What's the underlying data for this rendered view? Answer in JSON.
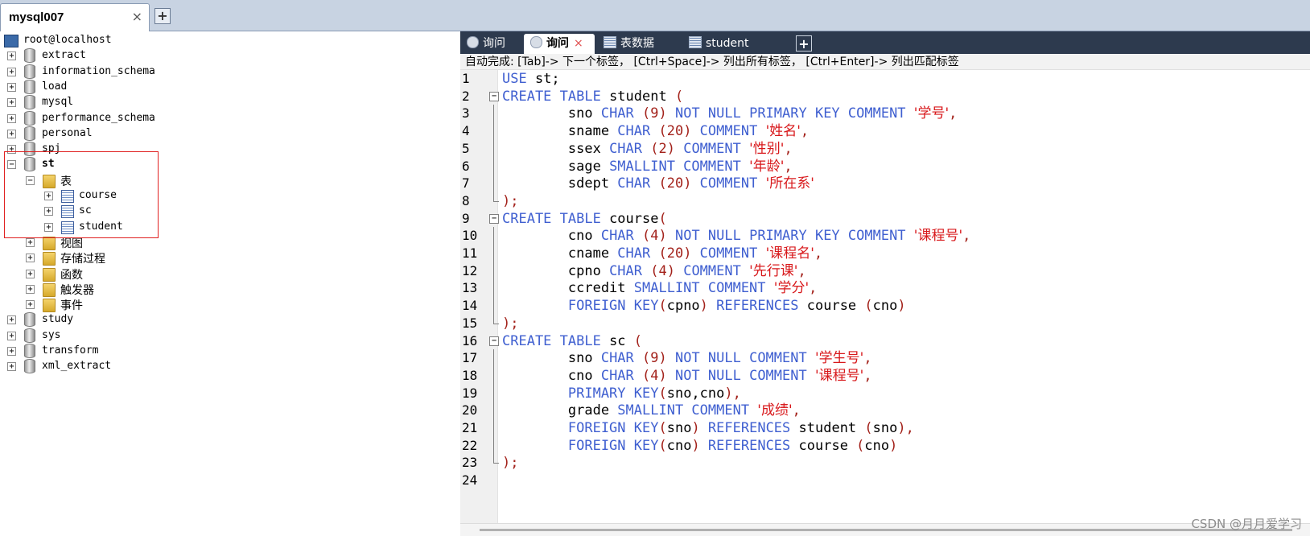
{
  "connection_tab": {
    "label": "mysql007",
    "close": "×",
    "add": "+"
  },
  "tree": {
    "rows": [
      {
        "level": 0,
        "icon": "host",
        "expander": "",
        "label": "root@localhost"
      },
      {
        "level": 1,
        "icon": "db",
        "expander": "+",
        "label": "extract"
      },
      {
        "level": 1,
        "icon": "db",
        "expander": "+",
        "label": "information_schema"
      },
      {
        "level": 1,
        "icon": "db",
        "expander": "+",
        "label": "load"
      },
      {
        "level": 1,
        "icon": "db",
        "expander": "+",
        "label": "mysql"
      },
      {
        "level": 1,
        "icon": "db",
        "expander": "+",
        "label": "performance_schema"
      },
      {
        "level": 1,
        "icon": "db",
        "expander": "+",
        "label": "personal"
      },
      {
        "level": 1,
        "icon": "db",
        "expander": "+",
        "label": "spj"
      },
      {
        "level": 1,
        "icon": "db",
        "expander": "−",
        "label": "st",
        "bold": true
      },
      {
        "level": 2,
        "icon": "folder",
        "expander": "−",
        "label": "表",
        "cn": true
      },
      {
        "level": 3,
        "icon": "table",
        "expander": "+",
        "label": "course"
      },
      {
        "level": 3,
        "icon": "table",
        "expander": "+",
        "label": "sc"
      },
      {
        "level": 3,
        "icon": "table",
        "expander": "+",
        "label": "student"
      },
      {
        "level": 2,
        "icon": "folder",
        "expander": "+",
        "label": "视图",
        "cn": true
      },
      {
        "level": 2,
        "icon": "folder",
        "expander": "+",
        "label": "存储过程",
        "cn": true
      },
      {
        "level": 2,
        "icon": "folder",
        "expander": "+",
        "label": "函数",
        "cn": true
      },
      {
        "level": 2,
        "icon": "folder",
        "expander": "+",
        "label": "触发器",
        "cn": true
      },
      {
        "level": 2,
        "icon": "folder",
        "expander": "+",
        "label": "事件",
        "cn": true
      },
      {
        "level": 1,
        "icon": "db",
        "expander": "+",
        "label": "study"
      },
      {
        "level": 1,
        "icon": "db",
        "expander": "+",
        "label": "sys"
      },
      {
        "level": 1,
        "icon": "db",
        "expander": "+",
        "label": "transform"
      },
      {
        "level": 1,
        "icon": "db",
        "expander": "+",
        "label": "xml_extract"
      }
    ]
  },
  "query_tabs": [
    {
      "label": "询问",
      "icon": "query-icon",
      "active": false
    },
    {
      "label": "询问",
      "icon": "query-icon",
      "active": true,
      "close": "×"
    },
    {
      "label": "表数据",
      "icon": "table-data-icon",
      "active": false
    },
    {
      "label": "student",
      "icon": "table-data-icon",
      "active": false
    }
  ],
  "add_query_tab": "+",
  "autocomplete_hint": "自动完成: [Tab]-> 下一个标签， [Ctrl+Space]-> 列出所有标签， [Ctrl+Enter]-> 列出匹配标签",
  "editor": {
    "lines": [
      {
        "n": "1",
        "fold": "",
        "tokens": [
          [
            "kw",
            "USE"
          ],
          [
            "id",
            " st;"
          ]
        ]
      },
      {
        "n": "2",
        "fold": "start",
        "tokens": [
          [
            "kw",
            "CREATE TABLE"
          ],
          [
            "id",
            " student "
          ],
          [
            "pun",
            "("
          ]
        ]
      },
      {
        "n": "3",
        "fold": "mid",
        "tokens": [
          [
            "id",
            "        sno "
          ],
          [
            "kw",
            "CHAR "
          ],
          [
            "pun",
            "(9) "
          ],
          [
            "kw",
            "NOT NULL PRIMARY KEY COMMENT "
          ],
          [
            "str",
            "'学号'"
          ],
          [
            "pun",
            ","
          ]
        ]
      },
      {
        "n": "4",
        "fold": "mid",
        "tokens": [
          [
            "id",
            "        sname "
          ],
          [
            "kw",
            "CHAR "
          ],
          [
            "pun",
            "(20) "
          ],
          [
            "kw",
            "COMMENT "
          ],
          [
            "str",
            "'姓名'"
          ],
          [
            "pun",
            ","
          ]
        ]
      },
      {
        "n": "5",
        "fold": "mid",
        "tokens": [
          [
            "id",
            "        ssex "
          ],
          [
            "kw",
            "CHAR "
          ],
          [
            "pun",
            "(2) "
          ],
          [
            "kw",
            "COMMENT "
          ],
          [
            "str",
            "'性别'"
          ],
          [
            "pun",
            ","
          ]
        ]
      },
      {
        "n": "6",
        "fold": "mid",
        "tokens": [
          [
            "id",
            "        sage "
          ],
          [
            "kw",
            "SMALLINT COMMENT "
          ],
          [
            "str",
            "'年龄'"
          ],
          [
            "pun",
            ","
          ]
        ]
      },
      {
        "n": "7",
        "fold": "mid",
        "tokens": [
          [
            "id",
            "        sdept "
          ],
          [
            "kw",
            "CHAR "
          ],
          [
            "pun",
            "(20) "
          ],
          [
            "kw",
            "COMMENT "
          ],
          [
            "str",
            "'所在系'"
          ]
        ]
      },
      {
        "n": "8",
        "fold": "end",
        "tokens": [
          [
            "pun",
            ");"
          ]
        ]
      },
      {
        "n": "9",
        "fold": "start",
        "tokens": [
          [
            "kw",
            "CREATE TABLE"
          ],
          [
            "id",
            " course"
          ],
          [
            "pun",
            "("
          ]
        ]
      },
      {
        "n": "10",
        "fold": "mid",
        "tokens": [
          [
            "id",
            "        cno "
          ],
          [
            "kw",
            "CHAR "
          ],
          [
            "pun",
            "(4) "
          ],
          [
            "kw",
            "NOT NULL PRIMARY KEY COMMENT "
          ],
          [
            "str",
            "'课程号'"
          ],
          [
            "pun",
            ","
          ]
        ]
      },
      {
        "n": "11",
        "fold": "mid",
        "tokens": [
          [
            "id",
            "        cname "
          ],
          [
            "kw",
            "CHAR "
          ],
          [
            "pun",
            "(20) "
          ],
          [
            "kw",
            "COMMENT "
          ],
          [
            "str",
            "'课程名'"
          ],
          [
            "pun",
            ","
          ]
        ]
      },
      {
        "n": "12",
        "fold": "mid",
        "tokens": [
          [
            "id",
            "        cpno "
          ],
          [
            "kw",
            "CHAR "
          ],
          [
            "pun",
            "(4) "
          ],
          [
            "kw",
            "COMMENT "
          ],
          [
            "str",
            "'先行课'"
          ],
          [
            "pun",
            ","
          ]
        ]
      },
      {
        "n": "13",
        "fold": "mid",
        "tokens": [
          [
            "id",
            "        ccredit "
          ],
          [
            "kw",
            "SMALLINT COMMENT "
          ],
          [
            "str",
            "'学分'"
          ],
          [
            "pun",
            ","
          ]
        ]
      },
      {
        "n": "14",
        "fold": "mid",
        "tokens": [
          [
            "kw",
            "        FOREIGN KEY"
          ],
          [
            "pun",
            "("
          ],
          [
            "id",
            "cpno"
          ],
          [
            "pun",
            ") "
          ],
          [
            "kw",
            "REFERENCES"
          ],
          [
            "id",
            " course "
          ],
          [
            "pun",
            "("
          ],
          [
            "id",
            "cno"
          ],
          [
            "pun",
            ")"
          ]
        ]
      },
      {
        "n": "15",
        "fold": "end",
        "tokens": [
          [
            "pun",
            ");"
          ]
        ]
      },
      {
        "n": "16",
        "fold": "start",
        "tokens": [
          [
            "kw",
            "CREATE TABLE"
          ],
          [
            "id",
            " sc "
          ],
          [
            "pun",
            "("
          ]
        ]
      },
      {
        "n": "17",
        "fold": "mid",
        "tokens": [
          [
            "id",
            "        sno "
          ],
          [
            "kw",
            "CHAR "
          ],
          [
            "pun",
            "(9) "
          ],
          [
            "kw",
            "NOT NULL COMMENT "
          ],
          [
            "str",
            "'学生号'"
          ],
          [
            "pun",
            ","
          ]
        ]
      },
      {
        "n": "18",
        "fold": "mid",
        "tokens": [
          [
            "id",
            "        cno "
          ],
          [
            "kw",
            "CHAR "
          ],
          [
            "pun",
            "(4) "
          ],
          [
            "kw",
            "NOT NULL COMMENT "
          ],
          [
            "str",
            "'课程号'"
          ],
          [
            "pun",
            ","
          ]
        ]
      },
      {
        "n": "19",
        "fold": "mid",
        "tokens": [
          [
            "kw",
            "        PRIMARY KEY"
          ],
          [
            "pun",
            "("
          ],
          [
            "id",
            "sno,cno"
          ],
          [
            "pun",
            "),"
          ]
        ]
      },
      {
        "n": "20",
        "fold": "mid",
        "tokens": [
          [
            "id",
            "        grade "
          ],
          [
            "kw",
            "SMALLINT COMMENT "
          ],
          [
            "str",
            "'成绩'"
          ],
          [
            "pun",
            ","
          ]
        ]
      },
      {
        "n": "21",
        "fold": "mid",
        "tokens": [
          [
            "kw",
            "        FOREIGN KEY"
          ],
          [
            "pun",
            "("
          ],
          [
            "id",
            "sno"
          ],
          [
            "pun",
            ") "
          ],
          [
            "kw",
            "REFERENCES"
          ],
          [
            "id",
            " student "
          ],
          [
            "pun",
            "("
          ],
          [
            "id",
            "sno"
          ],
          [
            "pun",
            "),"
          ]
        ]
      },
      {
        "n": "22",
        "fold": "mid",
        "tokens": [
          [
            "kw",
            "        FOREIGN KEY"
          ],
          [
            "pun",
            "("
          ],
          [
            "id",
            "cno"
          ],
          [
            "pun",
            ") "
          ],
          [
            "kw",
            "REFERENCES"
          ],
          [
            "id",
            " course "
          ],
          [
            "pun",
            "("
          ],
          [
            "id",
            "cno"
          ],
          [
            "pun",
            ")"
          ]
        ]
      },
      {
        "n": "23",
        "fold": "end",
        "tokens": [
          [
            "pun",
            ");"
          ]
        ]
      },
      {
        "n": "24",
        "fold": "",
        "tokens": []
      }
    ]
  },
  "watermark": "CSDN @月月爱学习",
  "colors": {
    "keyword": "#3f5fd0",
    "string": "#d8181b",
    "punct": "#a3221b",
    "highlight_box": "#e02020",
    "tab_strip": "#2d3a4e"
  }
}
